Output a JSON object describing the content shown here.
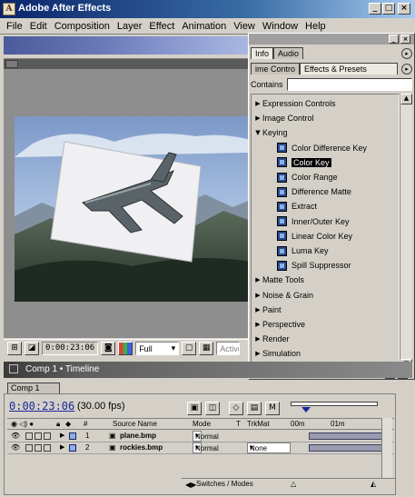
{
  "window": {
    "title": "Adobe After Effects"
  },
  "menu": [
    "File",
    "Edit",
    "Composition",
    "Layer",
    "Effect",
    "Animation",
    "View",
    "Window",
    "Help"
  ],
  "composition_footer": {
    "timecode": "0:00:23:06",
    "resolution": "Full",
    "camera": "Active"
  },
  "palette": {
    "tabs_top": [
      "Info",
      "Audio"
    ],
    "tabs_second": [
      "ime Contro",
      "Effects & Presets"
    ],
    "contains_label": "Contains",
    "contains_value": "",
    "items": [
      {
        "label": "Expression Controls",
        "level": 0,
        "expanded": false
      },
      {
        "label": "Image Control",
        "level": 0,
        "expanded": false
      },
      {
        "label": "Keying",
        "level": 0,
        "expanded": true
      },
      {
        "label": "Color Difference Key",
        "level": 1
      },
      {
        "label": "Color Key",
        "level": 1,
        "selected": true
      },
      {
        "label": "Color Range",
        "level": 1
      },
      {
        "label": "Difference Matte",
        "level": 1
      },
      {
        "label": "Extract",
        "level": 1
      },
      {
        "label": "Inner/Outer Key",
        "level": 1
      },
      {
        "label": "Linear Color Key",
        "level": 1
      },
      {
        "label": "Luma Key",
        "level": 1
      },
      {
        "label": "Spill Suppressor",
        "level": 1
      },
      {
        "label": "Matte Tools",
        "level": 0,
        "expanded": false
      },
      {
        "label": "Noise & Grain",
        "level": 0,
        "expanded": false
      },
      {
        "label": "Paint",
        "level": 0,
        "expanded": false
      },
      {
        "label": "Perspective",
        "level": 0,
        "expanded": false
      },
      {
        "label": "Render",
        "level": 0,
        "expanded": false
      },
      {
        "label": "Simulation",
        "level": 0,
        "expanded": false
      }
    ]
  },
  "timeline": {
    "window_title": "Comp 1 • Timeline",
    "tab": "Comp 1",
    "time": "0:00:23:06",
    "fps": "(30.00 fps)",
    "headers": {
      "num": "#",
      "source": "Source Name",
      "mode": "Mode",
      "t": "T",
      "trkmat": "TrkMat",
      "t0": "00m",
      "t1": "01m"
    },
    "layers": [
      {
        "num": "1",
        "source": "plane.bmp",
        "mode": "Normal",
        "trkmat": ""
      },
      {
        "num": "2",
        "source": "rockies.bmp",
        "mode": "Normal",
        "trkmat": "None"
      }
    ],
    "footer": "Switches / Modes"
  },
  "colors": {
    "title_bar": "#0a246a",
    "selection": "#000000",
    "time_blue": "#1a2a9a"
  }
}
